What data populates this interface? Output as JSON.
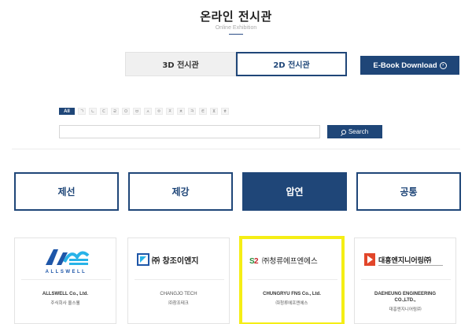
{
  "header": {
    "title": "온라인 전시관",
    "subtitle": "Online Exhibition"
  },
  "view_tabs": [
    {
      "label": "3D 전시관",
      "active": false
    },
    {
      "label": "2D 전시관",
      "active": true
    }
  ],
  "ebook": {
    "label": "E-Book Download"
  },
  "alphabet": [
    "All",
    "ㄱ",
    "ㄴ",
    "ㄷ",
    "ㄹ",
    "ㅁ",
    "ㅂ",
    "ㅅ",
    "ㅇ",
    "ㅈ",
    "ㅊ",
    "ㅋ",
    "ㅌ",
    "ㅍ",
    "ㅎ"
  ],
  "search": {
    "placeholder": "",
    "value": "",
    "button_label": "Search"
  },
  "categories": [
    {
      "label": "제선",
      "active": false
    },
    {
      "label": "제강",
      "active": false
    },
    {
      "label": "압연",
      "active": true
    },
    {
      "label": "공통",
      "active": false
    }
  ],
  "companies": [
    {
      "logo_text": "ALLSWELL",
      "name_en": "ALLSWELL Co., Ltd.",
      "name_en2": "",
      "name_ko": "주식회사 올스웰",
      "highlight": false
    },
    {
      "logo_text": "㈜ 창조이엔지",
      "name_en": "CHANGJO TECH",
      "name_en2": "",
      "name_ko": "㈜창조테크",
      "highlight": false
    },
    {
      "logo_text": "㈜청류에프엔에스",
      "name_en": "CHUNGRYU FNS Co., Ltd.",
      "name_en2": "",
      "name_ko": "㈜청류에프엔에스",
      "highlight": true
    },
    {
      "logo_text": "대흥엔지니어링㈜",
      "name_en": "DAEHEUNG ENGINEERING",
      "name_en2": "CO.,LTD.,",
      "name_ko": "대흥엔지니어링㈜",
      "highlight": false
    }
  ],
  "colors": {
    "brand": "#1f4678",
    "highlight": "#f5ee15"
  }
}
